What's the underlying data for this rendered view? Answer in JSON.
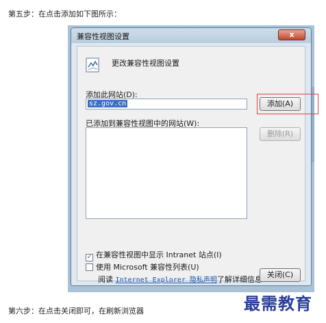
{
  "instructions": {
    "step5": "第五步：在点击添加如下图所示：",
    "step6": "第六步：在点击关闭即可，在刷新浏览器"
  },
  "dialog": {
    "title": "兼容性视图设置",
    "close_label": "x",
    "header": "更改兼容性视图设置",
    "add_site_label": "添加此网站(D):",
    "url_value": "sz.gov.cn",
    "add_button": "添加(A)",
    "list_label": "已添加到兼容性视图中的网站(W):",
    "remove_button": "删除(R)",
    "checkbox_intranet": {
      "label": "在兼容性视图中显示 Intranet 站点(I)",
      "checked": true
    },
    "checkbox_mslist": {
      "label": "使用 Microsoft 兼容性列表(U)",
      "checked": false
    },
    "read_prefix": "阅读",
    "privacy_link": "Internet Explorer 隐私声明",
    "read_suffix": "了解详细信息",
    "close_button": "关闭(C)"
  },
  "watermark": "最需教育",
  "colors": {
    "highlight": "#e04040",
    "link": "#1a55b0",
    "selection": "#3b6fc4"
  },
  "icons": {
    "header": "compatibility-view-icon"
  }
}
